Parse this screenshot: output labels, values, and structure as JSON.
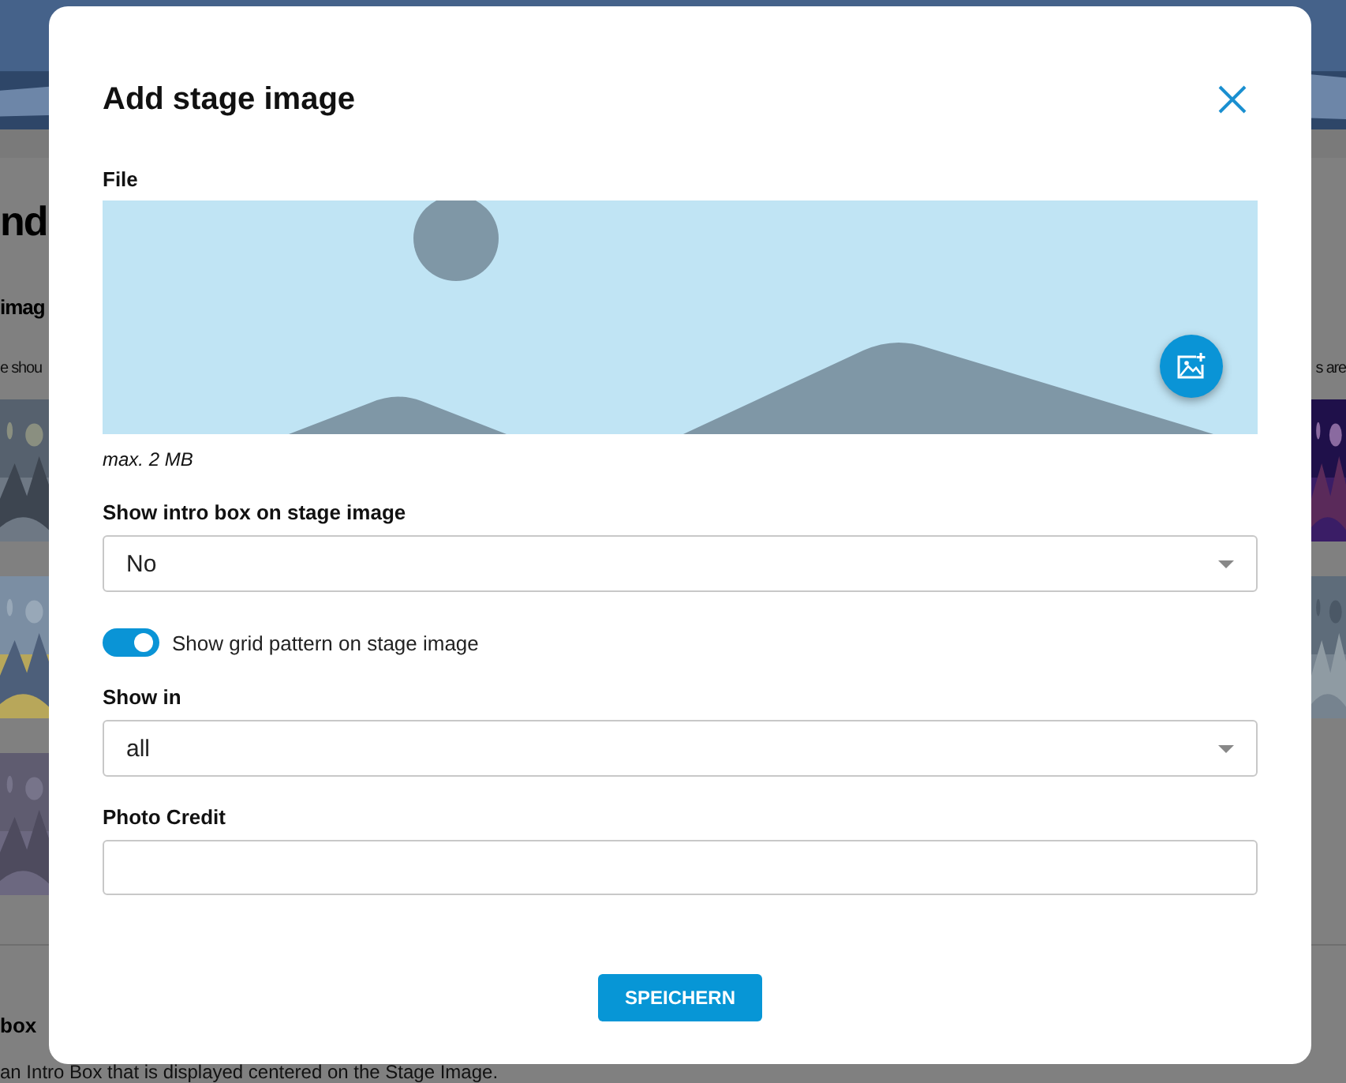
{
  "background": {
    "heading": "nd",
    "subheading": "imag",
    "text_left": "e shou",
    "text_right": "s are",
    "section_heading": "box",
    "section_text": "an Intro Box that is displayed centered on the Stage Image."
  },
  "dialog": {
    "title": "Add stage image",
    "file": {
      "label": "File",
      "hint": "max. 2 MB"
    },
    "fields": [
      {
        "kind": "select",
        "label": "Show intro box on stage image",
        "value": "No"
      },
      {
        "kind": "toggle",
        "label": "Show grid pattern on stage image",
        "on": true
      },
      {
        "kind": "select",
        "label": "Show in",
        "value": "all"
      },
      {
        "kind": "text",
        "label": "Photo Credit"
      }
    ],
    "buttons": [
      "SPEICHERN"
    ]
  }
}
